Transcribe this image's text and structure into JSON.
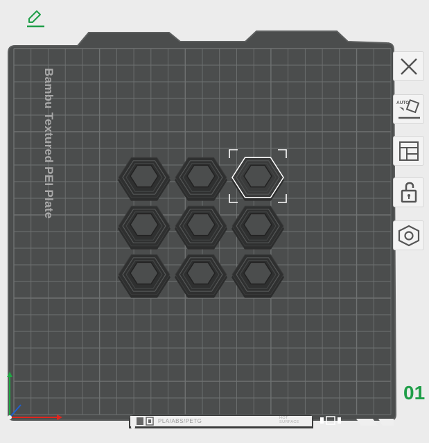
{
  "plate": {
    "title": "Bambu Textured PEI Plate",
    "number": "01",
    "filament_label": "PLA/ABS/PETG",
    "surface_label_line1": "HOT",
    "surface_label_line2": "SURFACE",
    "grid_columns": 22,
    "grid_rows": 22,
    "objects_selected_index": 2
  },
  "toolbar": {
    "close": {
      "icon": "close-icon"
    },
    "auto_orient": {
      "icon": "auto-orient-icon",
      "text": "AUTO"
    },
    "arrange": {
      "icon": "arrange-icon"
    },
    "lock": {
      "icon": "unlock-icon"
    },
    "settings": {
      "icon": "hex-nut-icon"
    },
    "edit": {
      "icon": "pencil-icon"
    }
  },
  "colors": {
    "plate": "#4b4d4d",
    "plate_border": "#5c5e5e",
    "grid": "#6f7272",
    "accent_green": "#1f9e48",
    "selection": "#ffffff"
  },
  "objects": [
    {
      "name": "hexagon-1",
      "selected": false
    },
    {
      "name": "hexagon-2",
      "selected": false
    },
    {
      "name": "hexagon-3",
      "selected": true
    },
    {
      "name": "hexagon-4",
      "selected": false
    },
    {
      "name": "hexagon-5",
      "selected": false
    },
    {
      "name": "hexagon-6",
      "selected": false
    },
    {
      "name": "hexagon-7",
      "selected": false
    },
    {
      "name": "hexagon-8",
      "selected": false
    },
    {
      "name": "hexagon-9",
      "selected": false
    }
  ]
}
